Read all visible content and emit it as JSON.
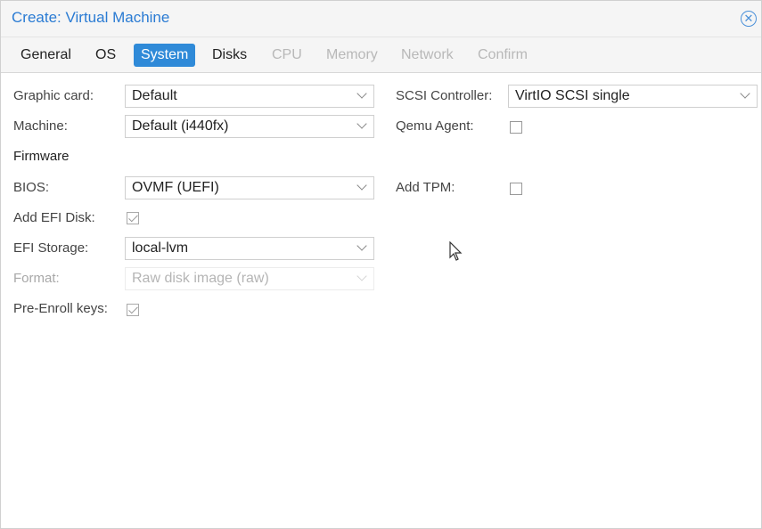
{
  "window": {
    "title": "Create: Virtual Machine",
    "close_icon": "close-circle-icon"
  },
  "tabs": [
    {
      "label": "General",
      "state": "enabled"
    },
    {
      "label": "OS",
      "state": "enabled"
    },
    {
      "label": "System",
      "state": "active"
    },
    {
      "label": "Disks",
      "state": "enabled"
    },
    {
      "label": "CPU",
      "state": "disabled"
    },
    {
      "label": "Memory",
      "state": "disabled"
    },
    {
      "label": "Network",
      "state": "disabled"
    },
    {
      "label": "Confirm",
      "state": "disabled"
    }
  ],
  "form": {
    "graphic_card": {
      "label": "Graphic card:",
      "value": "Default"
    },
    "machine": {
      "label": "Machine:",
      "value": "Default (i440fx)"
    },
    "firmware_heading": "Firmware",
    "bios": {
      "label": "BIOS:",
      "value": "OVMF (UEFI)"
    },
    "add_efi_disk": {
      "label": "Add EFI Disk:",
      "checked": true
    },
    "efi_storage": {
      "label": "EFI Storage:",
      "value": "local-lvm"
    },
    "format": {
      "label": "Format:",
      "value": "Raw disk image (raw)",
      "disabled": true
    },
    "pre_enroll_keys": {
      "label": "Pre-Enroll keys:",
      "checked": true
    },
    "scsi_controller": {
      "label": "SCSI Controller:",
      "value": "VirtIO SCSI single"
    },
    "qemu_agent": {
      "label": "Qemu Agent:",
      "checked": false
    },
    "add_tpm": {
      "label": "Add TPM:",
      "checked": false
    }
  },
  "colors": {
    "accent": "#2f8ad8",
    "title": "#2a7bd3"
  }
}
